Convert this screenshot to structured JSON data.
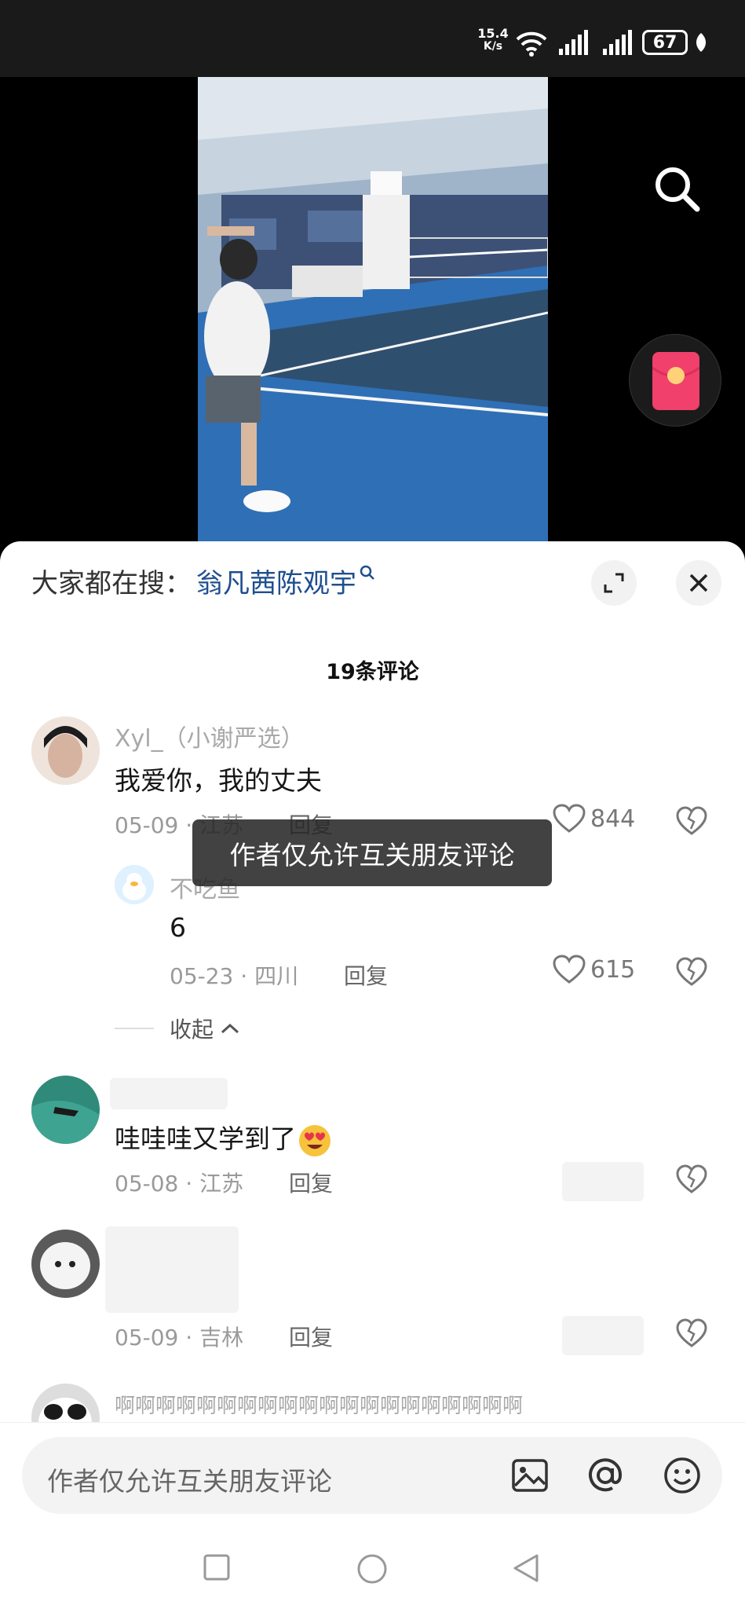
{
  "status_bar": {
    "net_speed_value": "15.4",
    "net_speed_unit": "K/s",
    "battery": "67"
  },
  "hot_search": {
    "prefix": "大家都在搜：",
    "term": "翁凡茜陈观宇"
  },
  "comments_header": {
    "count_label": "19条评论"
  },
  "comments": [
    {
      "name": "Xyl_（小谢严选）",
      "text": "我爱你，我的丈夫",
      "meta": "05-09 · 江苏",
      "reply": "回复",
      "likes": "844"
    },
    {
      "name": "不吃鱼",
      "text": "6",
      "meta": "05-23 · 四川",
      "reply": "回复",
      "likes": "615"
    },
    {
      "name": "",
      "text": "哇哇哇又学到了",
      "meta": "05-08 · 江苏",
      "reply": "回复",
      "likes": ""
    },
    {
      "name": "",
      "text": "",
      "meta": "05-09 · 吉林",
      "reply": "回复",
      "likes": ""
    },
    {
      "name": "啊啊啊啊啊啊啊啊啊啊啊啊啊啊啊啊啊啊啊啊",
      "text": "",
      "meta": "",
      "reply": "",
      "likes": ""
    }
  ],
  "collapse_label": "收起",
  "toast": "作者仅允许互关朋友评论",
  "input": {
    "placeholder": "作者仅允许互关朋友评论"
  },
  "colors": {
    "hot_term": "#1f4f8e",
    "redpacket": "#f0406b",
    "status_bg": "#1a1a1a"
  },
  "icons": [
    "search-icon",
    "red-packet-icon",
    "expand-icon",
    "close-icon",
    "heart-icon",
    "broken-heart-icon",
    "image-icon",
    "at-icon",
    "emoji-icon",
    "nav-recent-icon",
    "nav-home-icon",
    "nav-back-icon"
  ]
}
